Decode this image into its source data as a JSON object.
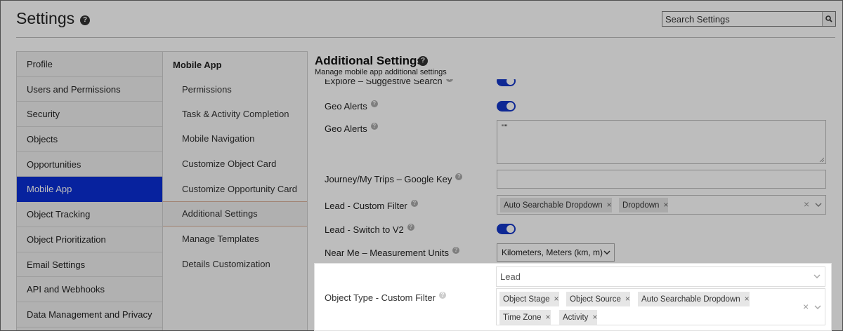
{
  "header": {
    "title": "Settings",
    "help_glyph": "?",
    "search_placeholder": "Search Settings"
  },
  "left_nav": {
    "items": [
      {
        "label": "Profile"
      },
      {
        "label": "Users and Permissions"
      },
      {
        "label": "Security"
      },
      {
        "label": "Objects"
      },
      {
        "label": "Opportunities"
      },
      {
        "label": "Mobile App",
        "active": true
      },
      {
        "label": "Object Tracking"
      },
      {
        "label": "Object Prioritization"
      },
      {
        "label": "Email Settings"
      },
      {
        "label": "API and Webhooks"
      },
      {
        "label": "Data Management and Privacy"
      }
    ]
  },
  "sub_nav": {
    "heading": "Mobile App",
    "items": [
      {
        "label": "Permissions"
      },
      {
        "label": "Task & Activity Completion"
      },
      {
        "label": "Mobile Navigation"
      },
      {
        "label": "Customize Object Card"
      },
      {
        "label": "Customize Opportunity Card"
      },
      {
        "label": "Additional Settings",
        "active": true
      },
      {
        "label": "Manage Templates"
      },
      {
        "label": "Details Customization"
      }
    ]
  },
  "main": {
    "title": "Additional Settings",
    "subtitle": "Manage mobile app additional settings",
    "rows": {
      "explore": {
        "label": "Explore – Suggestive Search",
        "enabled": true
      },
      "geo_alerts_toggle": {
        "label": "Geo Alerts",
        "enabled": true
      },
      "geo_alerts_text": {
        "label": "Geo Alerts",
        "value": "\"\""
      },
      "journey_key": {
        "label": "Journey/My Trips – Google Key",
        "value": ""
      },
      "lead_custom_filter": {
        "label": "Lead - Custom Filter",
        "chips": [
          "Auto Searchable Dropdown",
          "Dropdown"
        ]
      },
      "lead_switch": {
        "label": "Lead - Switch to V2",
        "enabled": true
      },
      "near_me_units": {
        "label": "Near Me – Measurement Units",
        "value": "Kilometers, Meters (km, m)"
      },
      "object_type_filter": {
        "label": "Object Type - Custom Filter",
        "type_value": "Lead",
        "chips": [
          "Object Stage",
          "Object Source",
          "Auto Searchable Dropdown",
          "Time Zone",
          "Activity"
        ]
      }
    },
    "remove_glyph": "×",
    "info_glyph": "?"
  },
  "icons": {
    "help": "help-circle-icon",
    "search": "search-icon",
    "info": "info-icon",
    "chevron": "chevron-down-icon",
    "clear": "clear-icon"
  },
  "colors": {
    "active_nav": "#0a2fd6",
    "toggle_on": "#1436c8"
  }
}
